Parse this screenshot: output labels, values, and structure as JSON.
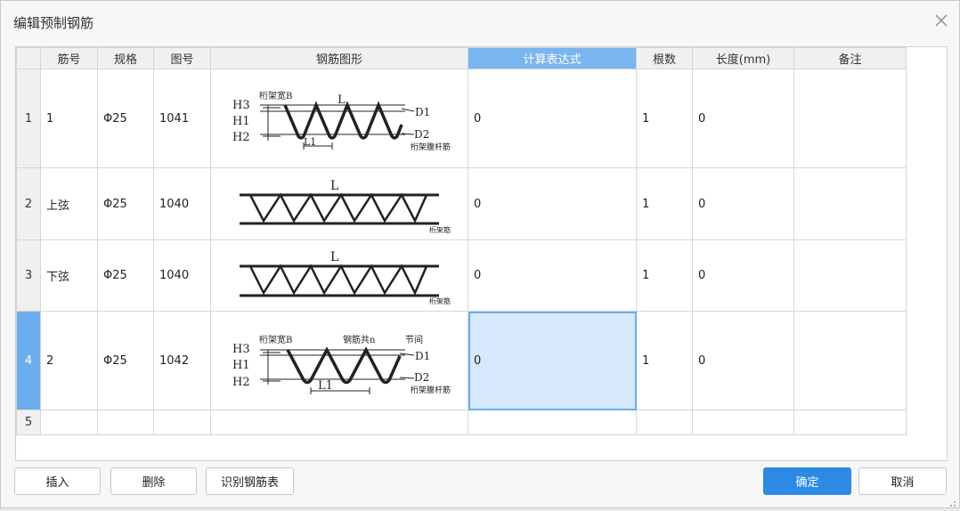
{
  "dialog": {
    "title": "编辑预制钢筋"
  },
  "columns": [
    "",
    "筋号",
    "规格",
    "图号",
    "钢筋图形",
    "计算表达式",
    "根数",
    "长度(mm)",
    "备注"
  ],
  "rows": [
    {
      "no": "1",
      "bar": "1",
      "spec": "Φ25",
      "fig": "1041",
      "expr": "0",
      "count": "1",
      "length": "0",
      "note": ""
    },
    {
      "no": "2",
      "bar": "上弦",
      "spec": "Φ25",
      "fig": "1040",
      "expr": "0",
      "count": "1",
      "length": "0",
      "note": ""
    },
    {
      "no": "3",
      "bar": "下弦",
      "spec": "Φ25",
      "fig": "1040",
      "expr": "0",
      "count": "1",
      "length": "0",
      "note": ""
    },
    {
      "no": "4",
      "bar": "2",
      "spec": "Φ25",
      "fig": "1042",
      "expr": "0",
      "count": "1",
      "length": "0",
      "note": ""
    },
    {
      "no": "5",
      "bar": "",
      "spec": "",
      "fig": "",
      "expr": "",
      "count": "",
      "length": "",
      "note": ""
    }
  ],
  "shapes": {
    "s1041": {
      "h3": "H3",
      "h1": "H1",
      "h2": "H2",
      "b": "桁架宽B",
      "l": "L",
      "l1": "L1",
      "d1": "D1",
      "d2": "D2",
      "web": "桁架腹杆筋"
    },
    "s1040": {
      "l": "L",
      "truss": "桁架筋"
    },
    "s1042": {
      "h3": "H3",
      "h1": "H1",
      "h2": "H2",
      "b": "桁架宽B",
      "n": "钢筋共n",
      "pitch": "节间",
      "l1": "L1",
      "d1": "D1",
      "d2": "D2",
      "web": "桁架腹杆筋"
    }
  },
  "buttons": {
    "insert": "插入",
    "delete": "删除",
    "recognize": "识别钢筋表",
    "ok": "确定",
    "cancel": "取消"
  },
  "colors": {
    "accent": "#2d8ae4",
    "header_active": "#79b5ee",
    "selection": "#d6e8fb"
  }
}
